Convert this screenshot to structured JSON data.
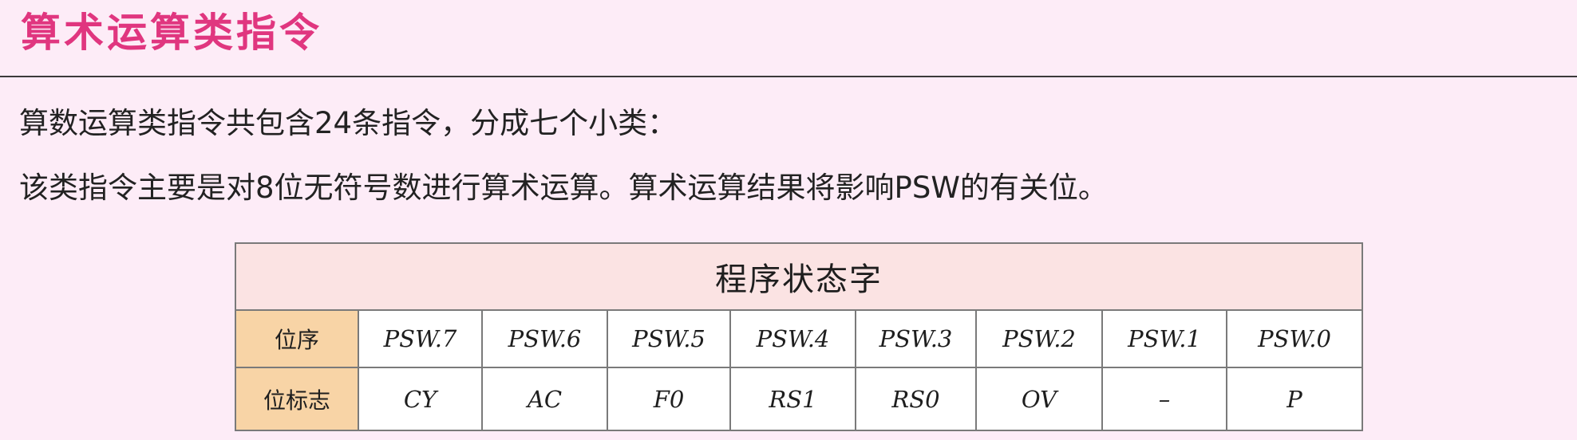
{
  "heading": {
    "title": "算术运算类指令"
  },
  "body": {
    "line1": "算数运算类指令共包含24条指令，分成七个小类：",
    "line2": "该类指令主要是对8位无符号数进行算术运算。算术运算结果将影响PSW的有关位。"
  },
  "psw_table": {
    "caption": "程序状态字",
    "row_order_label": "位序",
    "row_flag_label": "位标志",
    "bit_order": [
      "PSW.7",
      "PSW.6",
      "PSW.5",
      "PSW.4",
      "PSW.3",
      "PSW.2",
      "PSW.1",
      "PSW.0"
    ],
    "bit_flags": [
      "CY",
      "AC",
      "F0",
      "RS1",
      "RS0",
      "OV",
      "–",
      "P"
    ]
  },
  "colors": {
    "background": "#fdecf7",
    "title": "#e0367f",
    "caption_fill": "#fbe3e3",
    "row_header_fill": "#f8d4a6"
  }
}
